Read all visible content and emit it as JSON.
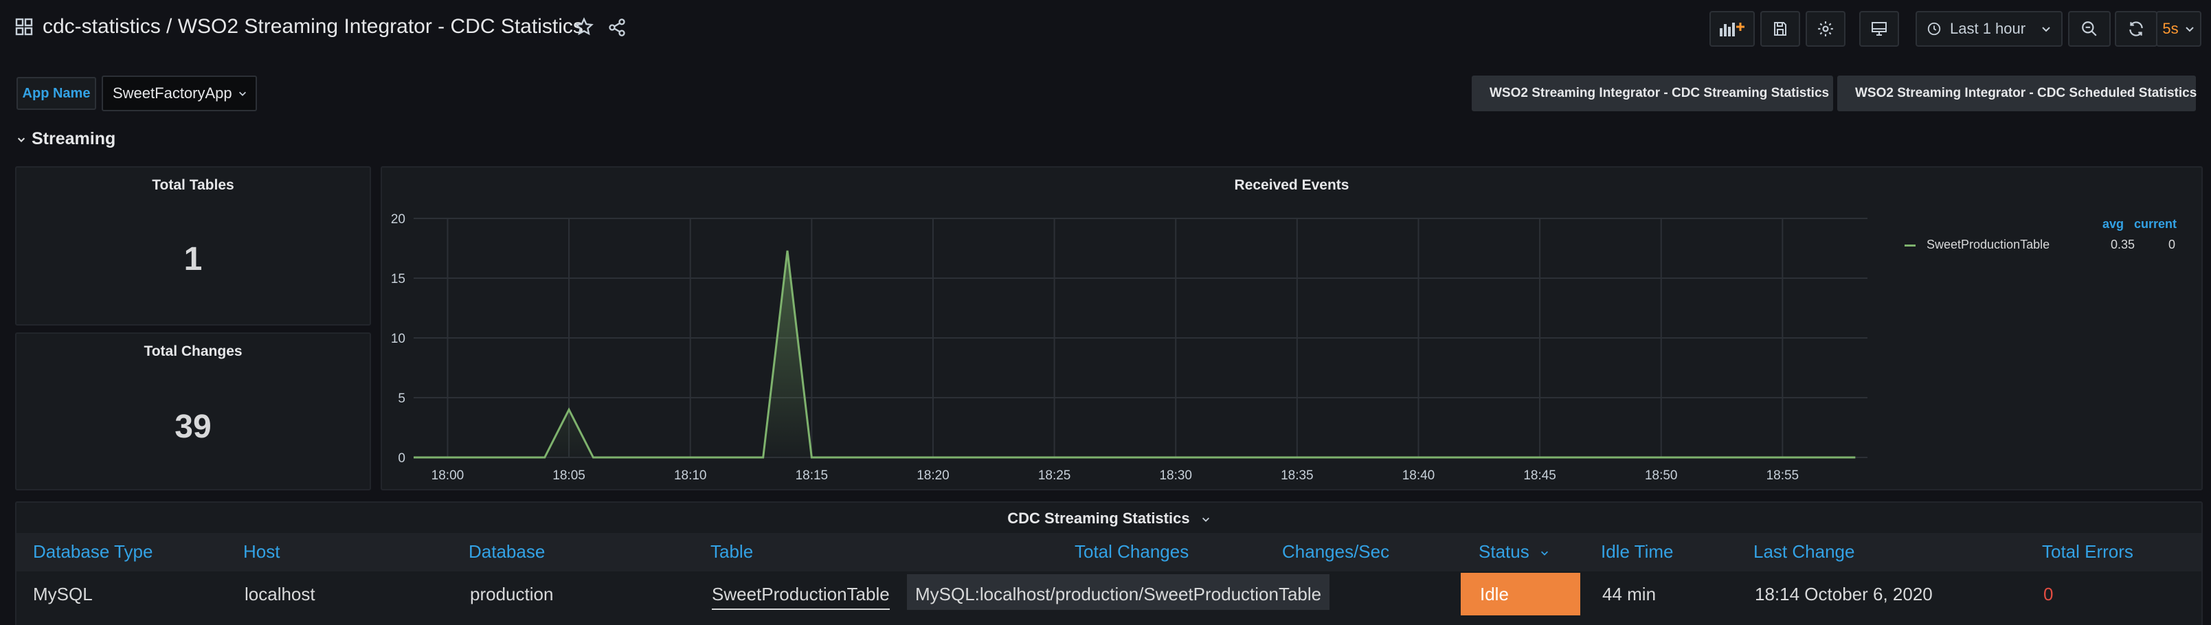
{
  "header": {
    "title": "cdc-statistics / WSO2 Streaming Integrator - CDC Statistics",
    "time_range_label": "Last 1 hour",
    "refresh_interval": "5s"
  },
  "variables": {
    "app_name_label": "App Name",
    "app_name_value": "SweetFactoryApp"
  },
  "links": [
    {
      "label": "WSO2 Streaming Integrator - CDC Streaming Statistics"
    },
    {
      "label": "WSO2 Streaming Integrator - CDC Scheduled Statistics"
    }
  ],
  "row": {
    "title": "Streaming"
  },
  "stats": {
    "total_tables": {
      "title": "Total Tables",
      "value": "1"
    },
    "total_changes": {
      "title": "Total Changes",
      "value": "39"
    }
  },
  "received_events": {
    "title": "Received Events",
    "legend": {
      "avg_header": "avg",
      "current_header": "current",
      "series_name": "SweetProductionTable",
      "avg": "0.35",
      "current": "0"
    }
  },
  "chart_data": {
    "type": "area",
    "title": "Received Events",
    "x_ticks": [
      "18:00",
      "18:05",
      "18:10",
      "18:15",
      "18:20",
      "18:25",
      "18:30",
      "18:35",
      "18:40",
      "18:45",
      "18:50",
      "18:55"
    ],
    "y_ticks": [
      "0",
      "5",
      "10",
      "15",
      "20"
    ],
    "ylim": [
      0,
      20
    ],
    "xlim_minutes": [
      -1.4,
      58.5
    ],
    "grid": true,
    "legend_position": "right",
    "series": [
      {
        "name": "SweetProductionTable",
        "color": "#7eb26d",
        "points": [
          [
            -1.4,
            0
          ],
          [
            4,
            0
          ],
          [
            5,
            4
          ],
          [
            6,
            0
          ],
          [
            13,
            0
          ],
          [
            14,
            17.3
          ],
          [
            15,
            0
          ],
          [
            58,
            0
          ]
        ]
      }
    ]
  },
  "cdc_table": {
    "title": "CDC Streaming Statistics",
    "columns": [
      "Database Type",
      "Host",
      "Database",
      "Table",
      "Total Changes",
      "Changes/Sec",
      "Status",
      "Idle Time",
      "Last Change",
      "Total Errors"
    ],
    "rows": [
      {
        "database_type": "MySQL",
        "host": "localhost",
        "database": "production",
        "table": "SweetProductionTable",
        "table_detail": "MySQL:localhost/production/SweetProductionTable",
        "status": "Idle",
        "idle_time": "44 min",
        "last_change": "18:14 October 6, 2020",
        "total_errors": "0"
      }
    ]
  },
  "colors": {
    "background": "#111217",
    "panel": "#181b1f",
    "accent_blue": "#33a2e5",
    "series_green": "#7eb26d",
    "status_idle": "#ef843c",
    "error_red": "#e24d42",
    "refresh_orange": "#ff9830"
  }
}
